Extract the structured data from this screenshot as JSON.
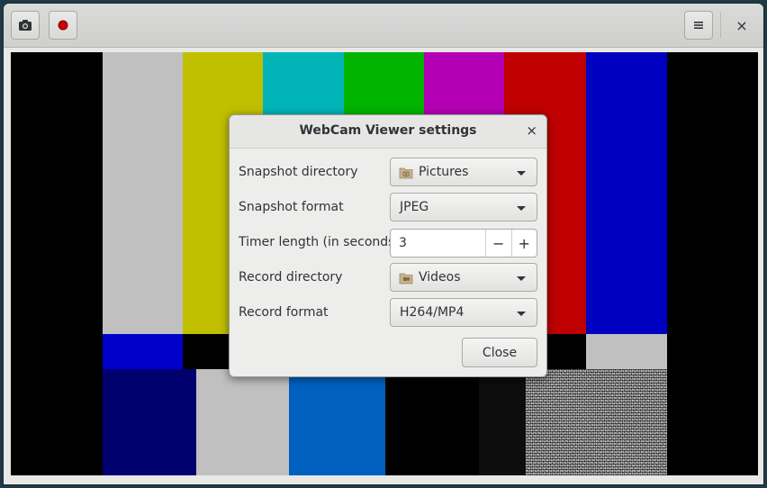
{
  "header": {
    "snapshot_icon": "camera-icon",
    "record_icon": "record-icon",
    "menu_icon": "hamburger-menu-icon",
    "close_label": "×"
  },
  "dialog": {
    "title": "WebCam Viewer settings",
    "close_label": "×",
    "rows": [
      {
        "label": "Snapshot directory",
        "value": "Pictures",
        "icon": "pictures-folder-icon"
      },
      {
        "label": "Snapshot format",
        "value": "JPEG"
      },
      {
        "label": "Timer length (in seconds)",
        "value": "3"
      },
      {
        "label": "Record directory",
        "value": "Videos",
        "icon": "videos-folder-icon"
      },
      {
        "label": "Record format",
        "value": "H264/MP4"
      }
    ],
    "spin_minus": "−",
    "spin_plus": "+",
    "close_button": "Close"
  },
  "colors": {
    "accent_record": "#cc0000",
    "bar_gray": "#c0c0c0",
    "bar_yellow": "#c0c000",
    "bar_cyan": "#00c0c0",
    "bar_green": "#00c000",
    "bar_magenta": "#c000c0",
    "bar_red": "#c00000",
    "bar_blue": "#0000c0",
    "navy": "#00006f",
    "mid_blue": "#0060c0"
  }
}
